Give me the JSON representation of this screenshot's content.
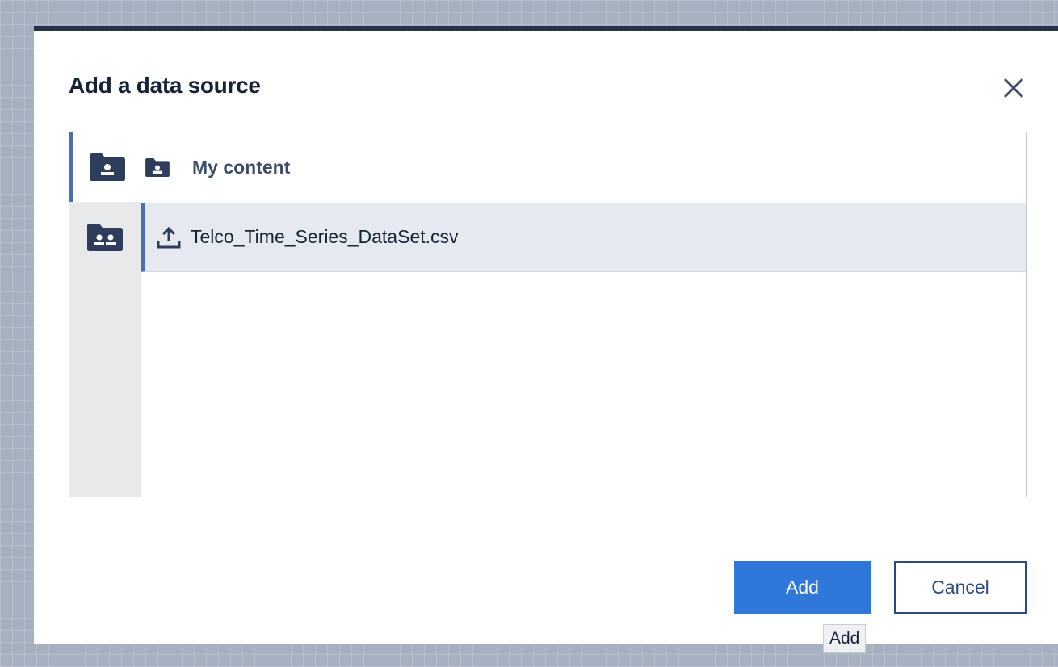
{
  "dialog": {
    "title": "Add a data source",
    "close_icon": "close-icon"
  },
  "rail": {
    "items": [
      {
        "icon": "my-content-folder-icon",
        "selected": true
      },
      {
        "icon": "team-content-folder-icon",
        "selected": false
      }
    ]
  },
  "folder": {
    "icon": "my-content-folder-icon",
    "label": "My content"
  },
  "files": [
    {
      "icon": "upload-icon",
      "name": "Telco_Time_Series_DataSet.csv",
      "selected": true
    }
  ],
  "buttons": {
    "add_label": "Add",
    "cancel_label": "Cancel"
  },
  "tooltip": {
    "text": "Add"
  },
  "colors": {
    "accent": "#2f77d8",
    "selection_bar": "#4a6fb0",
    "dialog_top_border": "#27324a",
    "row_selected_bg": "#e6e9f0"
  }
}
